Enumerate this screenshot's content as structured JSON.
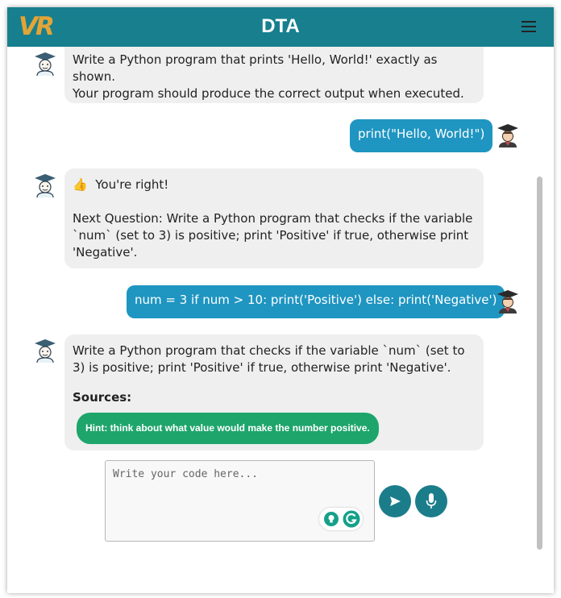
{
  "header": {
    "logo": "VR",
    "title": "DTA",
    "menu_icon": "hamburger-menu-icon"
  },
  "messages": [
    {
      "role": "bot",
      "lines": [
        "Write a Python program that prints 'Hello, World!' exactly as shown.",
        "Your program should produce the correct output when executed."
      ]
    },
    {
      "role": "user",
      "text": "print(\"Hello, World!\")"
    },
    {
      "role": "bot",
      "emoji": "👍",
      "first": "You're right!",
      "second": "Next Question: Write a Python program that checks if the variable `num` (set to 3) is positive; print 'Positive' if true, otherwise print 'Negative'."
    },
    {
      "role": "user",
      "text": "num = 3 if num > 10: print('Positive') else: print('Negative')"
    },
    {
      "role": "bot",
      "body": "Write a Python program that checks if the variable `num` (set to 3) is positive; print 'Positive' if true, otherwise print 'Negative'.",
      "sources_label": "Sources:",
      "hint": "Hint: think about what value would make the number positive."
    }
  ],
  "input": {
    "placeholder": "Write your code here...",
    "value": ""
  },
  "buttons": {
    "send_icon": "send-icon",
    "mic_icon": "microphone-icon"
  },
  "colors": {
    "header": "#177f8e",
    "logo": "#e3a437",
    "user_bubble": "#1f95c1",
    "bot_bubble": "#efefef",
    "hint": "#1ea56b",
    "round_button": "#1b7d8a"
  }
}
